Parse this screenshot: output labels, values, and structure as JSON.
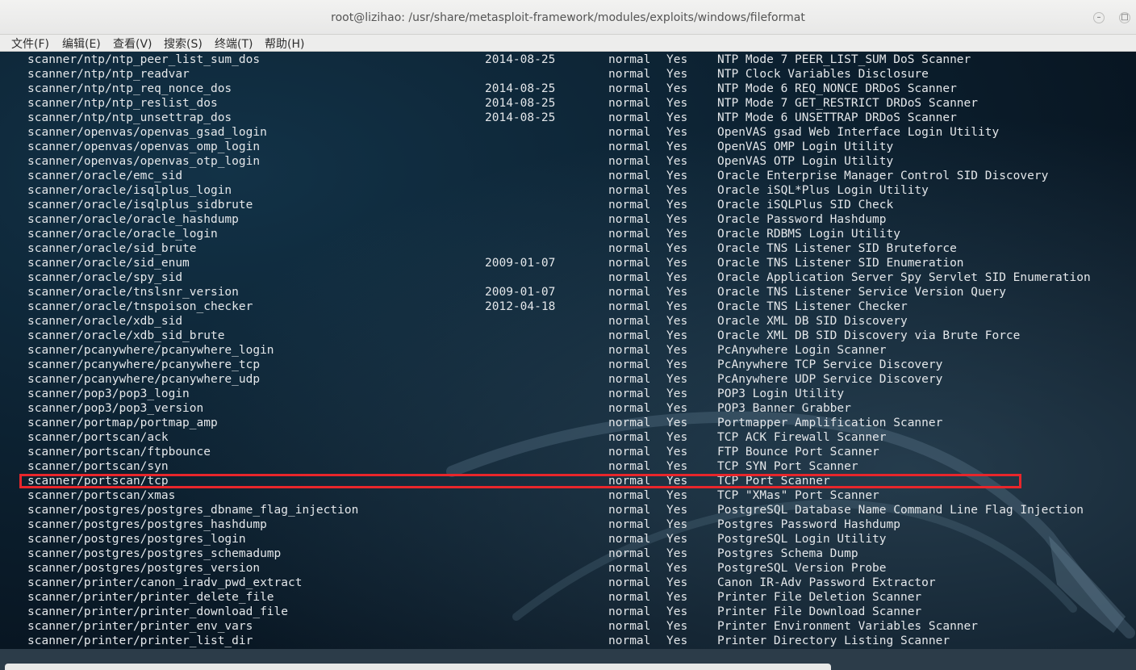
{
  "window": {
    "title": "root@lizihao: /usr/share/metasploit-framework/modules/exploits/windows/fileformat",
    "minimize_glyph": "–",
    "maximize_glyph": "□"
  },
  "menu": [
    "文件(F)",
    "编辑(E)",
    "查看(V)",
    "搜索(S)",
    "终端(T)",
    "帮助(H)"
  ],
  "colors": {
    "highlight_box": "#e8262b",
    "terminal_text": "#e4e7ea",
    "terminal_bg": "#0b1b28"
  },
  "rows": [
    {
      "name": "scanner/ntp/ntp_peer_list_sum_dos",
      "date": "2014-08-25",
      "rank": "normal",
      "check": "Yes",
      "desc": "NTP Mode 7 PEER_LIST_SUM DoS Scanner"
    },
    {
      "name": "scanner/ntp/ntp_readvar",
      "date": "",
      "rank": "normal",
      "check": "Yes",
      "desc": "NTP Clock Variables Disclosure"
    },
    {
      "name": "scanner/ntp/ntp_req_nonce_dos",
      "date": "2014-08-25",
      "rank": "normal",
      "check": "Yes",
      "desc": "NTP Mode 6 REQ_NONCE DRDoS Scanner"
    },
    {
      "name": "scanner/ntp/ntp_reslist_dos",
      "date": "2014-08-25",
      "rank": "normal",
      "check": "Yes",
      "desc": "NTP Mode 7 GET_RESTRICT DRDoS Scanner"
    },
    {
      "name": "scanner/ntp/ntp_unsettrap_dos",
      "date": "2014-08-25",
      "rank": "normal",
      "check": "Yes",
      "desc": "NTP Mode 6 UNSETTRAP DRDoS Scanner"
    },
    {
      "name": "scanner/openvas/openvas_gsad_login",
      "date": "",
      "rank": "normal",
      "check": "Yes",
      "desc": "OpenVAS gsad Web Interface Login Utility"
    },
    {
      "name": "scanner/openvas/openvas_omp_login",
      "date": "",
      "rank": "normal",
      "check": "Yes",
      "desc": "OpenVAS OMP Login Utility"
    },
    {
      "name": "scanner/openvas/openvas_otp_login",
      "date": "",
      "rank": "normal",
      "check": "Yes",
      "desc": "OpenVAS OTP Login Utility"
    },
    {
      "name": "scanner/oracle/emc_sid",
      "date": "",
      "rank": "normal",
      "check": "Yes",
      "desc": "Oracle Enterprise Manager Control SID Discovery"
    },
    {
      "name": "scanner/oracle/isqlplus_login",
      "date": "",
      "rank": "normal",
      "check": "Yes",
      "desc": "Oracle iSQL*Plus Login Utility"
    },
    {
      "name": "scanner/oracle/isqlplus_sidbrute",
      "date": "",
      "rank": "normal",
      "check": "Yes",
      "desc": "Oracle iSQLPlus SID Check"
    },
    {
      "name": "scanner/oracle/oracle_hashdump",
      "date": "",
      "rank": "normal",
      "check": "Yes",
      "desc": "Oracle Password Hashdump"
    },
    {
      "name": "scanner/oracle/oracle_login",
      "date": "",
      "rank": "normal",
      "check": "Yes",
      "desc": "Oracle RDBMS Login Utility"
    },
    {
      "name": "scanner/oracle/sid_brute",
      "date": "",
      "rank": "normal",
      "check": "Yes",
      "desc": "Oracle TNS Listener SID Bruteforce"
    },
    {
      "name": "scanner/oracle/sid_enum",
      "date": "2009-01-07",
      "rank": "normal",
      "check": "Yes",
      "desc": "Oracle TNS Listener SID Enumeration"
    },
    {
      "name": "scanner/oracle/spy_sid",
      "date": "",
      "rank": "normal",
      "check": "Yes",
      "desc": "Oracle Application Server Spy Servlet SID Enumeration"
    },
    {
      "name": "scanner/oracle/tnslsnr_version",
      "date": "2009-01-07",
      "rank": "normal",
      "check": "Yes",
      "desc": "Oracle TNS Listener Service Version Query"
    },
    {
      "name": "scanner/oracle/tnspoison_checker",
      "date": "2012-04-18",
      "rank": "normal",
      "check": "Yes",
      "desc": "Oracle TNS Listener Checker"
    },
    {
      "name": "scanner/oracle/xdb_sid",
      "date": "",
      "rank": "normal",
      "check": "Yes",
      "desc": "Oracle XML DB SID Discovery"
    },
    {
      "name": "scanner/oracle/xdb_sid_brute",
      "date": "",
      "rank": "normal",
      "check": "Yes",
      "desc": "Oracle XML DB SID Discovery via Brute Force"
    },
    {
      "name": "scanner/pcanywhere/pcanywhere_login",
      "date": "",
      "rank": "normal",
      "check": "Yes",
      "desc": "PcAnywhere Login Scanner"
    },
    {
      "name": "scanner/pcanywhere/pcanywhere_tcp",
      "date": "",
      "rank": "normal",
      "check": "Yes",
      "desc": "PcAnywhere TCP Service Discovery"
    },
    {
      "name": "scanner/pcanywhere/pcanywhere_udp",
      "date": "",
      "rank": "normal",
      "check": "Yes",
      "desc": "PcAnywhere UDP Service Discovery"
    },
    {
      "name": "scanner/pop3/pop3_login",
      "date": "",
      "rank": "normal",
      "check": "Yes",
      "desc": "POP3 Login Utility"
    },
    {
      "name": "scanner/pop3/pop3_version",
      "date": "",
      "rank": "normal",
      "check": "Yes",
      "desc": "POP3 Banner Grabber"
    },
    {
      "name": "scanner/portmap/portmap_amp",
      "date": "",
      "rank": "normal",
      "check": "Yes",
      "desc": "Portmapper Amplification Scanner"
    },
    {
      "name": "scanner/portscan/ack",
      "date": "",
      "rank": "normal",
      "check": "Yes",
      "desc": "TCP ACK Firewall Scanner"
    },
    {
      "name": "scanner/portscan/ftpbounce",
      "date": "",
      "rank": "normal",
      "check": "Yes",
      "desc": "FTP Bounce Port Scanner"
    },
    {
      "name": "scanner/portscan/syn",
      "date": "",
      "rank": "normal",
      "check": "Yes",
      "desc": "TCP SYN Port Scanner"
    },
    {
      "name": "scanner/portscan/tcp",
      "date": "",
      "rank": "normal",
      "check": "Yes",
      "desc": "TCP Port Scanner"
    },
    {
      "name": "scanner/portscan/xmas",
      "date": "",
      "rank": "normal",
      "check": "Yes",
      "desc": "TCP \"XMas\" Port Scanner"
    },
    {
      "name": "scanner/postgres/postgres_dbname_flag_injection",
      "date": "",
      "rank": "normal",
      "check": "Yes",
      "desc": "PostgreSQL Database Name Command Line Flag Injection"
    },
    {
      "name": "scanner/postgres/postgres_hashdump",
      "date": "",
      "rank": "normal",
      "check": "Yes",
      "desc": "Postgres Password Hashdump"
    },
    {
      "name": "scanner/postgres/postgres_login",
      "date": "",
      "rank": "normal",
      "check": "Yes",
      "desc": "PostgreSQL Login Utility"
    },
    {
      "name": "scanner/postgres/postgres_schemadump",
      "date": "",
      "rank": "normal",
      "check": "Yes",
      "desc": "Postgres Schema Dump"
    },
    {
      "name": "scanner/postgres/postgres_version",
      "date": "",
      "rank": "normal",
      "check": "Yes",
      "desc": "PostgreSQL Version Probe"
    },
    {
      "name": "scanner/printer/canon_iradv_pwd_extract",
      "date": "",
      "rank": "normal",
      "check": "Yes",
      "desc": "Canon IR-Adv Password Extractor"
    },
    {
      "name": "scanner/printer/printer_delete_file",
      "date": "",
      "rank": "normal",
      "check": "Yes",
      "desc": "Printer File Deletion Scanner"
    },
    {
      "name": "scanner/printer/printer_download_file",
      "date": "",
      "rank": "normal",
      "check": "Yes",
      "desc": "Printer File Download Scanner"
    },
    {
      "name": "scanner/printer/printer_env_vars",
      "date": "",
      "rank": "normal",
      "check": "Yes",
      "desc": "Printer Environment Variables Scanner"
    },
    {
      "name": "scanner/printer/printer_list_dir",
      "date": "",
      "rank": "normal",
      "check": "Yes",
      "desc": "Printer Directory Listing Scanner"
    }
  ]
}
